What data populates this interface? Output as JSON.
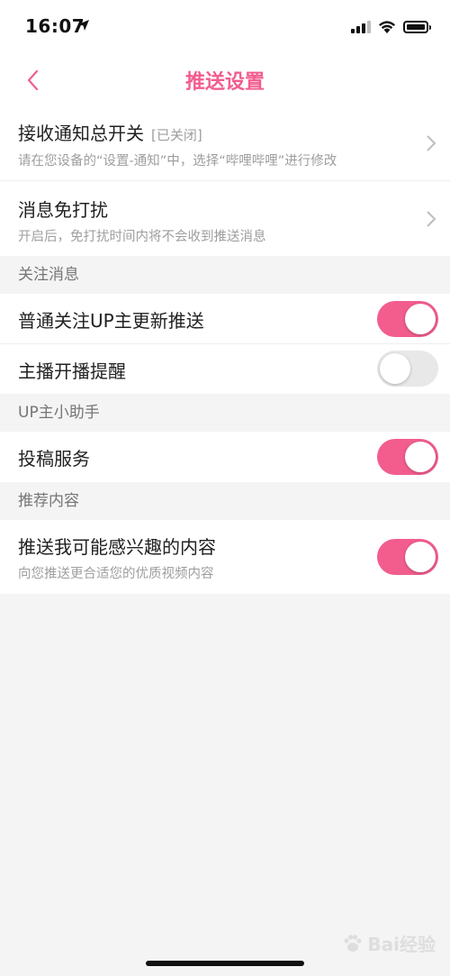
{
  "status_bar": {
    "time": "16:07"
  },
  "nav": {
    "title": "推送设置"
  },
  "top_settings": [
    {
      "title": "接收通知总开关",
      "tag": "[已关闭]",
      "subtitle": "请在您设备的“设置-通知”中，选择“哔哩哔哩”进行修改"
    },
    {
      "title": "消息免打扰",
      "subtitle": "开启后，免打扰时间内将不会收到推送消息"
    }
  ],
  "sections": [
    {
      "header": "关注消息",
      "items": [
        {
          "title": "普通关注UP主更新推送",
          "enabled": true
        },
        {
          "title": "主播开播提醒",
          "enabled": false
        }
      ]
    },
    {
      "header": "UP主小助手",
      "items": [
        {
          "title": "投稿服务",
          "enabled": true
        }
      ]
    },
    {
      "header": "推荐内容",
      "items": [
        {
          "title": "推送我可能感兴趣的内容",
          "subtitle": "向您推送更合适您的优质视频内容",
          "enabled": true
        }
      ]
    }
  ],
  "watermark": {
    "text": "Bai经验"
  },
  "colors": {
    "accent": "#f25d8e",
    "toggle_off": "#e8e8e8",
    "background": "#f4f4f4"
  },
  "icons": [
    "location-arrow-icon",
    "signal-icon",
    "wifi-icon",
    "battery-icon",
    "back-chevron-icon",
    "chevron-right-icon"
  ]
}
